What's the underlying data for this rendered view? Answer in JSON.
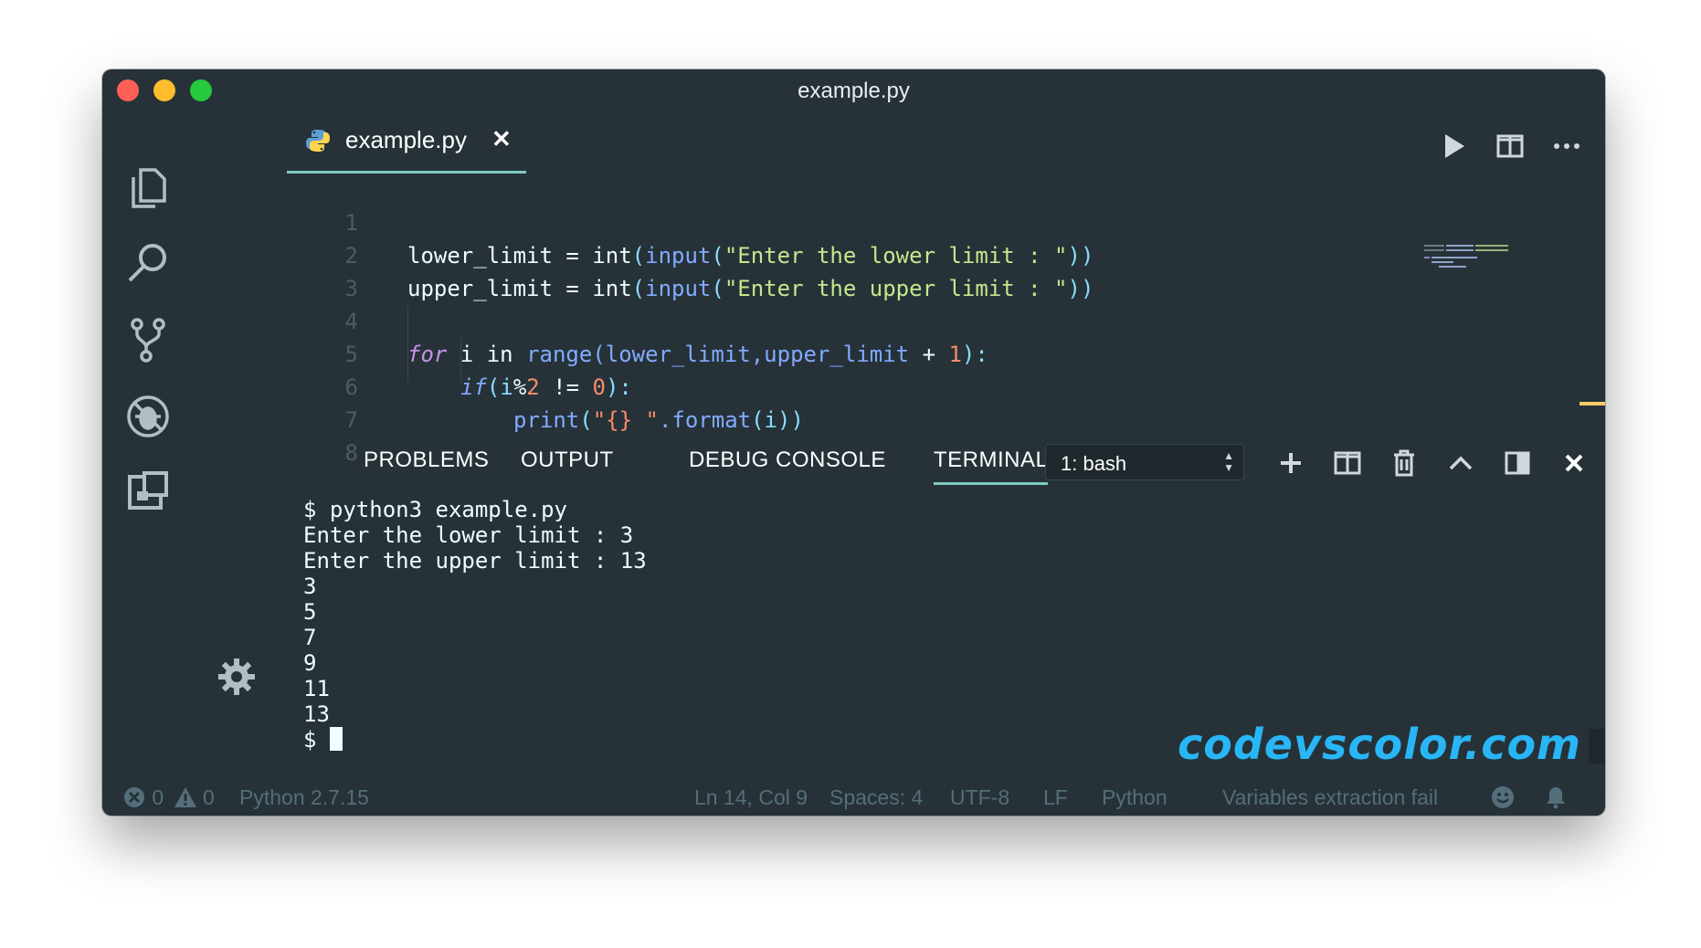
{
  "window": {
    "title": "example.py"
  },
  "tab": {
    "label": "example.py",
    "close": "✕"
  },
  "editor": {
    "line_numbers": [
      "1",
      "2",
      "3",
      "4",
      "5",
      "6",
      "7",
      "8"
    ],
    "code": {
      "l1_var": "lower_limit",
      "l1_eq": " = ",
      "l1_int": "int",
      "l1_p1": "(",
      "l1_input": "input",
      "l1_p2": "(",
      "l1_str": "\"Enter the lower limit : \"",
      "l1_close": "))",
      "l2_var": "upper_limit",
      "l2_eq": " = ",
      "l2_int": "int",
      "l2_p1": "(",
      "l2_input": "input",
      "l2_p2": "(",
      "l2_str": "\"Enter the upper limit : \"",
      "l2_close": "))",
      "l4_for": "for",
      "l4_i": " i ",
      "l4_in": "in",
      "l4_range": " range",
      "l4_args": "(lower_limit,upper_limit ",
      "l4_plus": "+",
      "l4_sp": " ",
      "l4_one": "1",
      "l4_close": "):",
      "l5_if": "if",
      "l5_a": "(i",
      "l5_mod": "%",
      "l5_two": "2",
      "l5_b": " != ",
      "l5_zero": "0",
      "l5_close": "):",
      "l6_print": "print",
      "l6_a": "(",
      "l6_str": "\"{} \"",
      "l6_format": ".format",
      "l6_b": "(i))"
    }
  },
  "panel": {
    "tabs": [
      "PROBLEMS",
      "OUTPUT",
      "DEBUG CONSOLE",
      "TERMINAL"
    ],
    "shell_select": "1: bash",
    "terminal_lines": [
      "$ python3 example.py",
      "Enter the lower limit : 3",
      "Enter the upper limit : 13",
      "3",
      "5",
      "7",
      "9",
      "11",
      "13"
    ],
    "prompt": "$ ",
    "watermark": "codevscolor.com"
  },
  "statusbar": {
    "errors": "0",
    "warnings": "0",
    "interpreter": "Python 2.7.15",
    "position": "Ln 14, Col 9",
    "spaces": "Spaces: 4",
    "encoding": "UTF-8",
    "eol": "LF",
    "language": "Python",
    "message": "Variables extraction fail"
  },
  "icons": {
    "activity": [
      "files-icon",
      "search-icon",
      "source-control-icon",
      "debug-icon",
      "extensions-icon",
      "gear-icon"
    ],
    "editor_actions": [
      "run-icon",
      "split-editor-icon",
      "more-icon"
    ],
    "panel_actions": [
      "plus-icon",
      "split-terminal-icon",
      "trash-icon",
      "chevron-up-icon",
      "maximize-panel-icon",
      "close-icon"
    ]
  },
  "colors": {
    "background": "#263238",
    "accent": "#80cbc4",
    "keyword": "#c792ea",
    "function": "#82aaff",
    "string": "#c3e88d",
    "number": "#f78c6c",
    "watermark": "#29b6f6"
  }
}
